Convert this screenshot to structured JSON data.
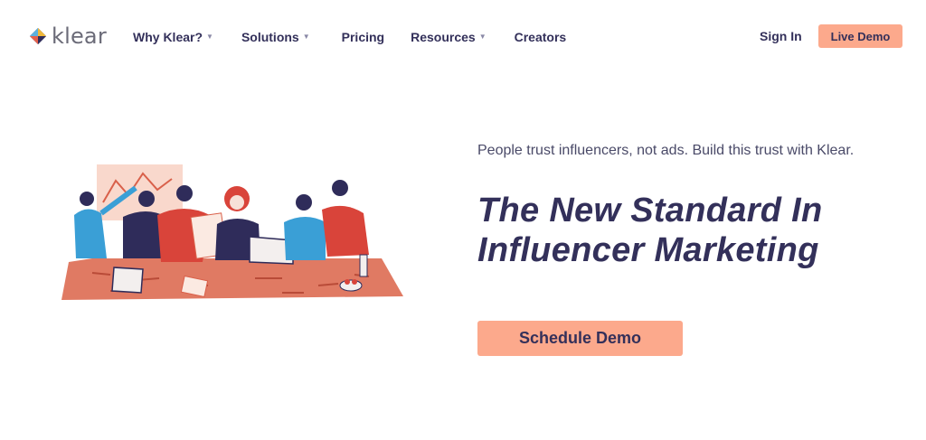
{
  "brand": {
    "name": "klear",
    "logo_icon": "klear-diamond-logo-icon"
  },
  "nav": {
    "items": [
      {
        "label": "Why Klear?",
        "has_dropdown": true
      },
      {
        "label": "Solutions",
        "has_dropdown": true
      },
      {
        "label": "Pricing",
        "has_dropdown": false
      },
      {
        "label": "Resources",
        "has_dropdown": true
      },
      {
        "label": "Creators",
        "has_dropdown": false
      }
    ],
    "dropdown_icon": "caret-down-icon",
    "sign_in": "Sign In",
    "live_demo": "Live Demo"
  },
  "hero": {
    "tagline": "People trust influencers, not ads. Build this trust with Klear.",
    "title_line1": "The New Standard In",
    "title_line2": "Influencer Marketing",
    "cta": "Schedule Demo",
    "illustration": "team-collaboration-illustration"
  },
  "colors": {
    "accent": "#fca98c",
    "text_dark": "#33305a",
    "text_muted": "#4a4a68",
    "illustration_red": "#d9604a",
    "illustration_blue": "#3a9fd6"
  }
}
